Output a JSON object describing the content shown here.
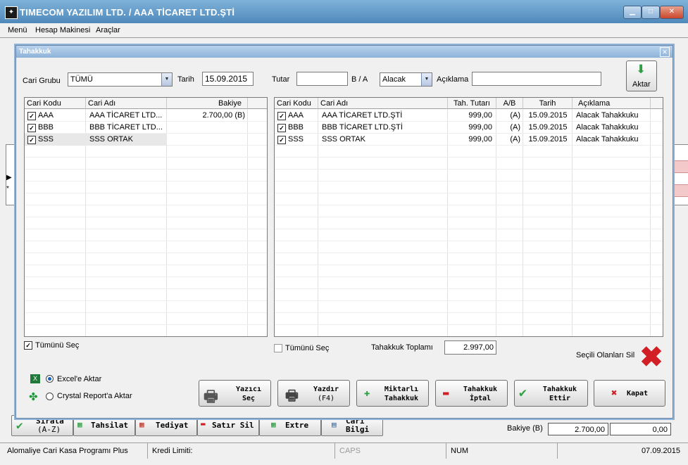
{
  "app": {
    "title": "TIMECOM YAZILIM LTD. / AAA TİCARET LTD.ŞTİ",
    "menu": [
      "Menü",
      "Hesap Makinesi",
      "Araçlar"
    ]
  },
  "background": {
    "bottom_buttons": [
      {
        "label1": "Sırala",
        "label2": "(A-Z)"
      },
      {
        "label1": "Tahsilat",
        "label2": ""
      },
      {
        "label1": "Tediyat",
        "label2": ""
      },
      {
        "label1": "Satır Sil",
        "label2": ""
      },
      {
        "label1": "Extre",
        "label2": ""
      },
      {
        "label1": "Cari",
        "label2": "Bilgi"
      }
    ],
    "bakiye_label": "Bakiye (B)",
    "bakiye_value": "2.700,00",
    "bakiye_value2": "0,00",
    "row_markers": [
      "▶",
      "*"
    ]
  },
  "statusbar": {
    "app_name": "Alomaliye Cari Kasa Programı Plus",
    "kredi": "Kredi Limiti:",
    "caps": "CAPS",
    "num": "NUM",
    "date": "07.09.2015"
  },
  "dialog": {
    "title": "Tahakkuk",
    "cari_grubu_label": "Cari Grubu",
    "cari_grubu_value": "TÜMÜ",
    "tarih_label": "Tarih",
    "tarih_value": "15.09.2015",
    "tutar_label": "Tutar",
    "tutar_value": "",
    "ba_label": "B / A",
    "ba_value": "Alacak",
    "aciklama_label": "Açıklama",
    "aciklama_value": "",
    "aktar_label": "Aktar",
    "left_grid": {
      "headers": [
        "Cari Kodu",
        "Cari Adı",
        "Bakiye"
      ],
      "rows": [
        {
          "checked": true,
          "kod": "AAA",
          "ad": "AAA TİCARET LTD...",
          "bakiye": "2.700,00 (B)"
        },
        {
          "checked": true,
          "kod": "BBB",
          "ad": "BBB TİCARET LTD...",
          "bakiye": ""
        },
        {
          "checked": true,
          "kod": "SSS",
          "ad": "SSS ORTAK",
          "bakiye": ""
        }
      ]
    },
    "right_grid": {
      "headers": [
        "Cari Kodu",
        "Cari Adı",
        "Tah. Tutarı",
        "A/B",
        "Tarih",
        "Açıklama"
      ],
      "rows": [
        {
          "checked": true,
          "kod": "AAA",
          "ad": "AAA TİCARET LTD.ŞTİ",
          "tutar": "999,00",
          "ab": "(A)",
          "tarih": "15.09.2015",
          "aciklama": "Alacak Tahakkuku"
        },
        {
          "checked": true,
          "kod": "BBB",
          "ad": "BBB TİCARET LTD.ŞTİ",
          "tutar": "999,00",
          "ab": "(A)",
          "tarih": "15.09.2015",
          "aciklama": "Alacak Tahakkuku"
        },
        {
          "checked": true,
          "kod": "SSS",
          "ad": "SSS ORTAK",
          "tutar": "999,00",
          "ab": "(A)",
          "tarih": "15.09.2015",
          "aciklama": "Alacak Tahakkuku"
        }
      ]
    },
    "left_select_all": {
      "label": "Tümünü Seç",
      "checked": true
    },
    "right_select_all": {
      "label": "Tümünü Seç",
      "checked": false
    },
    "toplam_label": "Tahakkuk Toplamı",
    "toplam_value": "2.997,00",
    "secili_sil_label": "Seçili Olanları Sil",
    "excel_label": "Excel'e Aktar",
    "crystal_label": "Crystal Report'a Aktar",
    "buttons": [
      {
        "l1": "Yazıcı",
        "l2": "Seç"
      },
      {
        "l1": "Yazdır",
        "l2": "(F4)"
      },
      {
        "l1": "Miktarlı",
        "l2": "Tahakkuk"
      },
      {
        "l1": "Tahakkuk",
        "l2": "İptal"
      },
      {
        "l1": "Tahakkuk",
        "l2": "Ettir"
      },
      {
        "l1": "Kapat",
        "l2": ""
      }
    ],
    "colors": {
      "accent": "#2b86c8",
      "delete_red": "#d21f26",
      "green": "#2ea043"
    }
  }
}
